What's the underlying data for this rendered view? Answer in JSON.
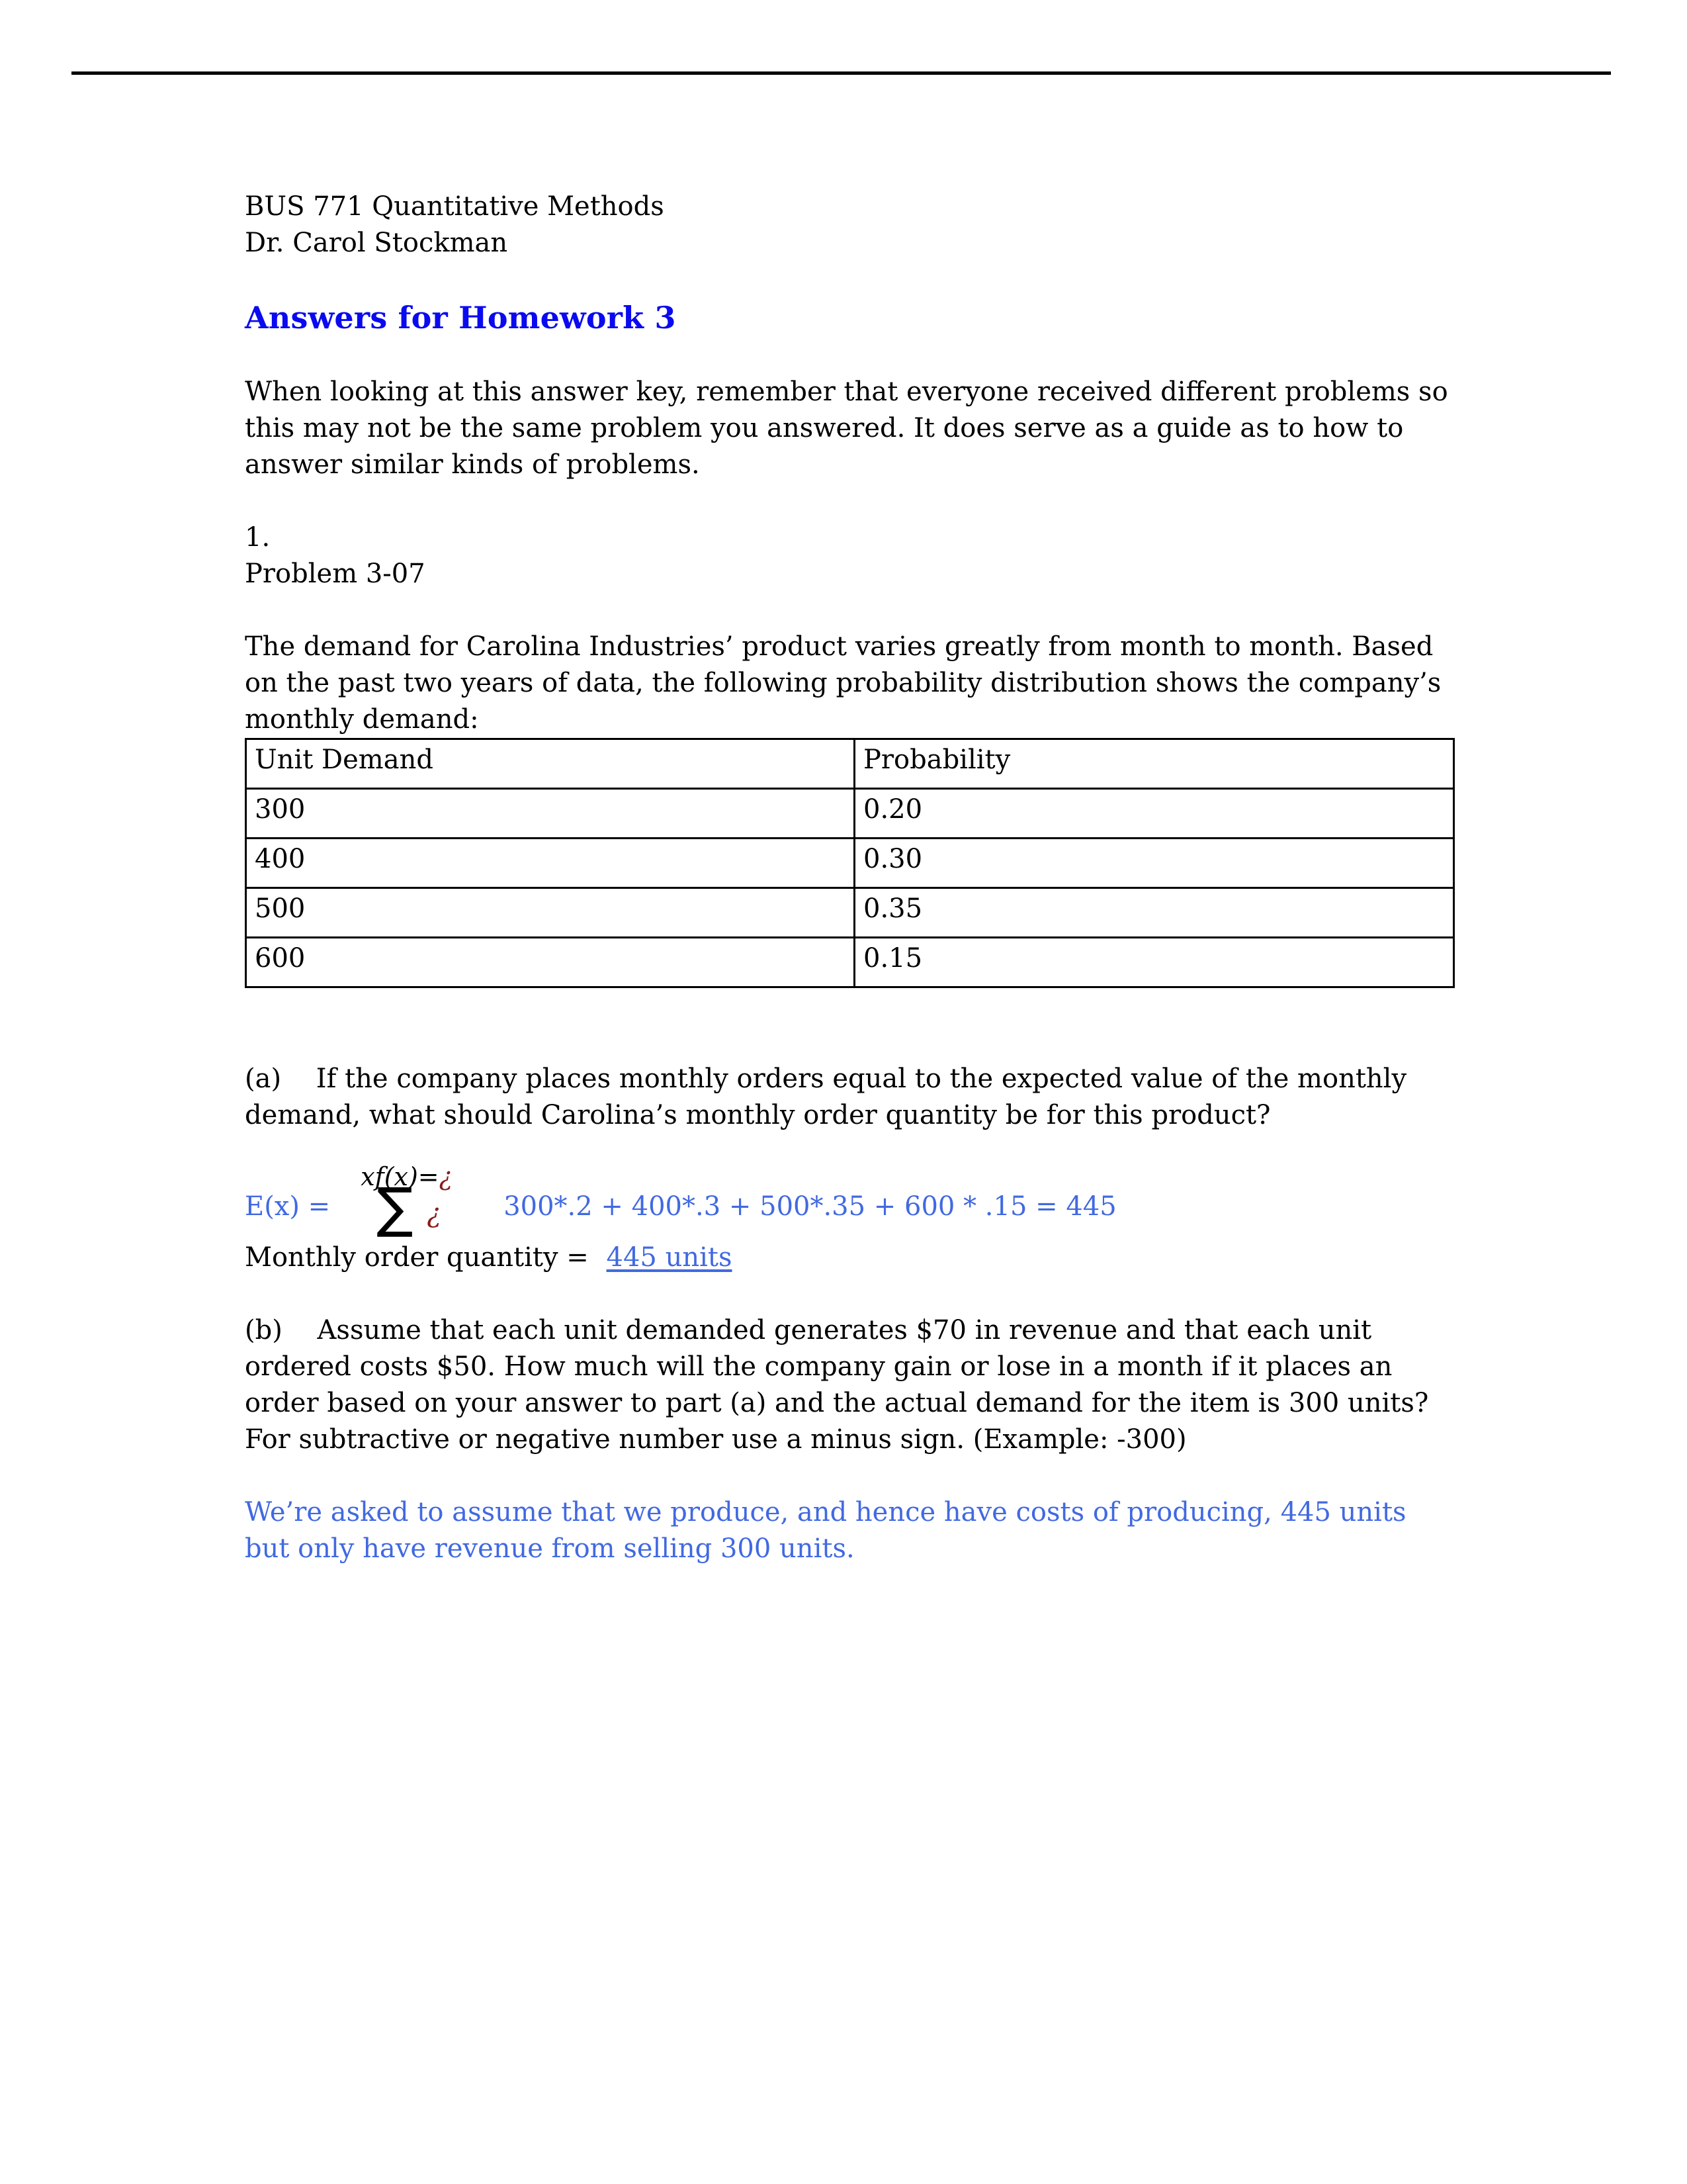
{
  "document": {
    "course_line": "BUS 771 Quantitative Methods",
    "instructor_line": "Dr. Carol Stockman",
    "heading": "Answers for Homework 3",
    "intro_paragraph": "When looking at this answer key, remember that everyone received different problems so this may not be the same problem you answered. It does serve as a guide as to how to answer similar kinds of problems.",
    "question_number": "1.",
    "problem_label": "Problem 3-07",
    "problem_statement": "The demand for Carolina Industries’ product varies greatly from month to month. Based on the past two years of data, the following probability distribution shows the company’s monthly demand:"
  },
  "table": {
    "columns": [
      "Unit Demand",
      "Probability"
    ],
    "rows": [
      [
        "300",
        "0.20"
      ],
      [
        "400",
        "0.30"
      ],
      [
        "500",
        "0.35"
      ],
      [
        "600",
        "0.15"
      ]
    ]
  },
  "part_a": {
    "prompt": "(a)  If the company places monthly orders equal to the expected value of the monthly demand, what should Carolina’s monthly order quantity be for this product?",
    "formula_lhs": "E(x) = ",
    "formula_numerator": "xf",
    "formula_numerator_arg": "(x)",
    "formula_numerator_eq": "=",
    "formula_numerator_marker": "¿",
    "formula_sigma": "∑",
    "formula_sigma_marker": "¿",
    "formula_rhs": "300*.2 + 400*.3 + 500*.35 + 600 * .15 =  445",
    "answer_label": "Monthly order quantity = ",
    "answer_value": "445  units"
  },
  "part_b": {
    "prompt": "(b)  Assume that each unit demanded generates $70 in revenue and that each unit ordered costs $50. How much will the company gain or lose in a month if it places an order based on your answer to part (a) and the actual demand for the item is 300 units?",
    "note": "For subtractive or negative number use a minus sign. (Example: -300)",
    "answer_paragraph": "We’re asked to assume that we produce, and hence have costs of producing, 445 units but only have revenue from selling 300 units."
  },
  "colors": {
    "heading_blue": "#0a0af0",
    "body_blue": "#4169e1",
    "marker_red": "#8b1a1a",
    "text_black": "#000000",
    "page_background": "#ffffff"
  }
}
